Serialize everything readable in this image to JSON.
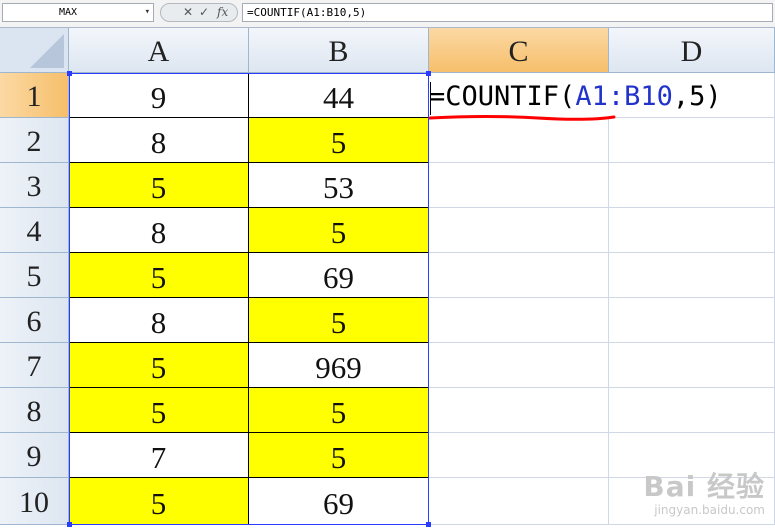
{
  "formula_bar": {
    "name_box": "MAX",
    "name_box_arrow": "▾",
    "cancel_symbol": "✕",
    "enter_symbol": "✓",
    "fx_symbol": "fx",
    "formula": "=COUNTIF(A1:B10,5)"
  },
  "columns": [
    "A",
    "B",
    "C",
    "D"
  ],
  "rows": [
    "1",
    "2",
    "3",
    "4",
    "5",
    "6",
    "7",
    "8",
    "9",
    "10"
  ],
  "cells": {
    "A": [
      "9",
      "8",
      "5",
      "8",
      "5",
      "8",
      "5",
      "5",
      "7",
      "5"
    ],
    "B": [
      "44",
      "5",
      "53",
      "5",
      "69",
      "5",
      "969",
      "5",
      "5",
      "69"
    ]
  },
  "active_cell": {
    "prefix": "=COUNTIF(",
    "range": "A1:B10",
    "suffix": ",5)"
  },
  "highlight_color": "#ffff00",
  "underline_color": "#ff0000",
  "watermark": {
    "brand": "Bai 经验",
    "url": "jingyan.baidu.com"
  }
}
